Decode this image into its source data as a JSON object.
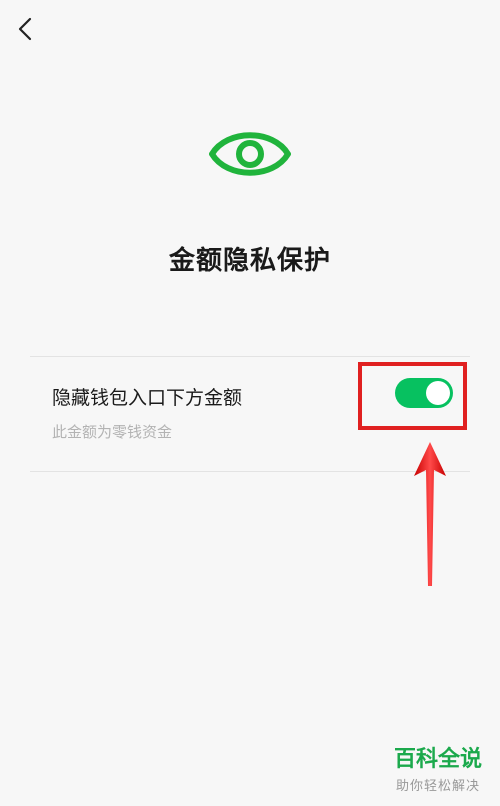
{
  "page": {
    "title": "金额隐私保护"
  },
  "setting": {
    "title": "隐藏钱包入口下方金额",
    "description": "此金额为零钱资金",
    "toggle_on": true
  },
  "watermark": {
    "title": "百科全说",
    "subtitle": "助你轻松解决"
  },
  "colors": {
    "accent": "#07c160",
    "highlight": "#e02020"
  },
  "icons": {
    "back": "chevron-left-icon",
    "eye": "eye-icon"
  }
}
